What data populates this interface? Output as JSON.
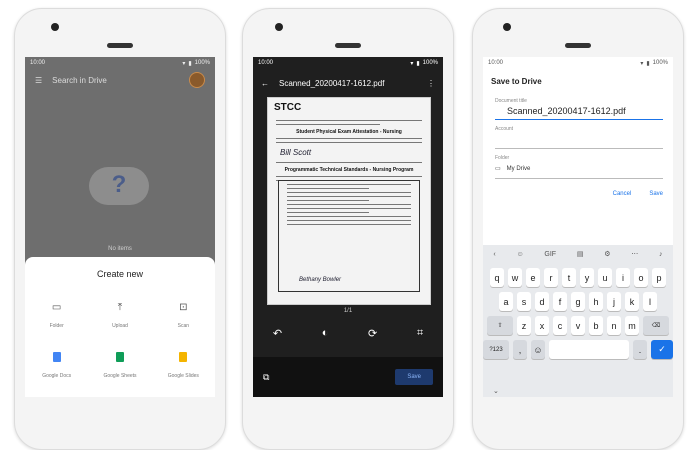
{
  "phone1": {
    "status": {
      "time": "10:00",
      "battery": "100%"
    },
    "search_placeholder": "Search in Drive",
    "empty_label": "No items",
    "sheet_title": "Create new",
    "items": [
      {
        "label": "Folder",
        "icon": "folder-icon"
      },
      {
        "label": "Upload",
        "icon": "upload-icon"
      },
      {
        "label": "Scan",
        "icon": "camera-icon"
      },
      {
        "label": "Google Docs",
        "icon": "docs-icon"
      },
      {
        "label": "Google Sheets",
        "icon": "sheets-icon"
      },
      {
        "label": "Google Slides",
        "icon": "slides-icon"
      }
    ]
  },
  "phone2": {
    "status": {
      "time": "10:00",
      "battery": "100%"
    },
    "title": "Scanned_20200417-1612.pdf",
    "doc": {
      "logo": "STCC",
      "heading": "Student Physical Exam Attestation - Nursing",
      "name": "Bill Scott",
      "subheading": "Programmatic Technical Standards - Nursing Program",
      "signature": "Bethany Bowler"
    },
    "page_indicator": "1/1",
    "save_label": "Save"
  },
  "phone3": {
    "status": {
      "time": "10:00",
      "battery": "100%"
    },
    "dialog_title": "Save to Drive",
    "doc_title_label": "Document title",
    "doc_title_value": "Scanned_20200417-1612.pdf",
    "account_label": "Account",
    "folder_label": "Folder",
    "folder_value": "My Drive",
    "cancel_label": "Cancel",
    "save_label": "Save",
    "keyboard": {
      "row1": [
        "q",
        "w",
        "e",
        "r",
        "t",
        "y",
        "u",
        "i",
        "o",
        "p"
      ],
      "row2": [
        "a",
        "s",
        "d",
        "f",
        "g",
        "h",
        "j",
        "k",
        "l"
      ],
      "row3": [
        "z",
        "x",
        "c",
        "v",
        "b",
        "n",
        "m"
      ],
      "symbols_label": "?123",
      "period": "."
    }
  },
  "colors": {
    "accent": "#1a73e8",
    "scanner_bg": "#1f1f1f",
    "overlay": "#6e6e6e"
  }
}
